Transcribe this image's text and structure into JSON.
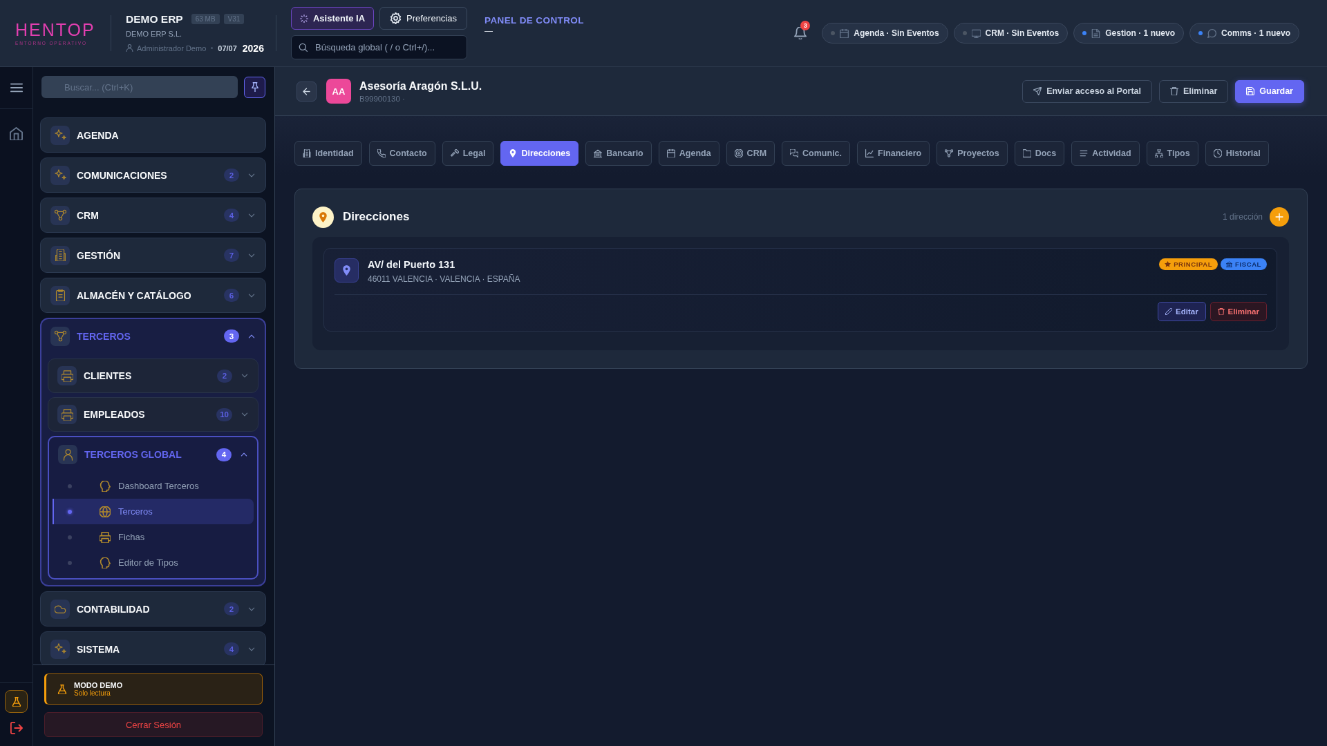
{
  "header": {
    "logo": "HENTOP",
    "logo_tagline": "ENTORNO OPERATIVO",
    "app_name": "DEMO ERP",
    "tags": [
      "63 MB",
      "V31"
    ],
    "company": "DEMO ERP S.L.",
    "user": "Administrador Demo",
    "date": "07/07",
    "year": "2026",
    "buttons": [
      {
        "label": "Asistente IA",
        "kind": "assistant"
      },
      {
        "label": "Preferencias",
        "kind": "settings"
      }
    ],
    "search": {
      "placeholder": "Búsqueda global ( / o Ctrl+/)..."
    },
    "section": "PANEL DE CONTROL",
    "section_subtitle": "—",
    "notification_count": "3",
    "status_pills": [
      {
        "label": "Agenda · Sin Eventos",
        "unread": false
      },
      {
        "label": "CRM · Sin Eventos",
        "unread": false
      },
      {
        "label": "Gestion · 1 nuevo",
        "unread": true
      },
      {
        "label": "Comms · 1 nuevo",
        "unread": true
      }
    ]
  },
  "sidebar": {
    "search": {
      "placeholder": "Buscar... (Ctrl+K)"
    },
    "items": [
      {
        "label": "AGENDA"
      },
      {
        "label": "COMUNICACIONES",
        "count": "2",
        "expanded": false
      },
      {
        "label": "CRM",
        "count": "4",
        "expanded": false
      },
      {
        "label": "GESTIÓN",
        "count": "7",
        "expanded": false
      },
      {
        "label": "ALMACÉN Y CATÁLOGO",
        "count": "6",
        "expanded": false
      },
      {
        "label": "TERCEROS",
        "count": "3",
        "expanded": true,
        "children": [
          {
            "label": "CLIENTES",
            "count": "2",
            "expanded": false
          },
          {
            "label": "EMPLEADOS",
            "count": "10",
            "expanded": false
          },
          {
            "label": "TERCEROS GLOBAL",
            "count": "4",
            "expanded": true,
            "children": [
              {
                "label": "Dashboard Terceros",
                "selected": false
              },
              {
                "label": "Terceros",
                "selected": true
              },
              {
                "label": "Fichas",
                "selected": false
              },
              {
                "label": "Editor de Tipos",
                "selected": false
              }
            ]
          }
        ]
      },
      {
        "label": "CONTABILIDAD",
        "count": "2",
        "expanded": false
      },
      {
        "label": "SISTEMA",
        "count": "4",
        "expanded": false
      }
    ],
    "demo_notice": {
      "title": "MODO DEMO",
      "subtitle": "Solo lectura"
    },
    "logout_button": "Cerrar Sesión"
  },
  "record": {
    "avatar": "AA",
    "name": "Asesoría Aragón S.L.U.",
    "code": "B99900130 ·",
    "actions": [
      {
        "label": "Enviar acceso al Portal",
        "kind": "send"
      },
      {
        "label": "Eliminar",
        "kind": "delete"
      },
      {
        "label": "Guardar",
        "kind": "save"
      }
    ]
  },
  "tabs": [
    {
      "label": "Identidad",
      "selected": false
    },
    {
      "label": "Contacto",
      "selected": false
    },
    {
      "label": "Legal",
      "selected": false
    },
    {
      "label": "Direcciones",
      "selected": true
    },
    {
      "label": "Bancario",
      "selected": false
    },
    {
      "label": "Agenda",
      "selected": false
    },
    {
      "label": "CRM",
      "selected": false
    },
    {
      "label": "Comunic.",
      "selected": false
    },
    {
      "label": "Financiero",
      "selected": false
    },
    {
      "label": "Proyectos",
      "selected": false
    },
    {
      "label": "Docs",
      "selected": false
    },
    {
      "label": "Actividad",
      "selected": false
    },
    {
      "label": "Tipos",
      "selected": false
    },
    {
      "label": "Historial",
      "selected": false
    }
  ],
  "addresses_panel": {
    "title": "Direcciones",
    "count": "1 dirección",
    "addresses": [
      {
        "street": "AV/ del Puerto 131",
        "locality": "46011 VALENCIA · VALENCIA · ESPAÑA",
        "tags": [
          {
            "label": "PRINCIPAL",
            "kind": "principal"
          },
          {
            "label": "FISCAL",
            "kind": "fiscal"
          }
        ],
        "actions": [
          {
            "label": "Editar",
            "kind": "edit"
          },
          {
            "label": "Eliminar",
            "kind": "delete"
          }
        ]
      }
    ]
  }
}
